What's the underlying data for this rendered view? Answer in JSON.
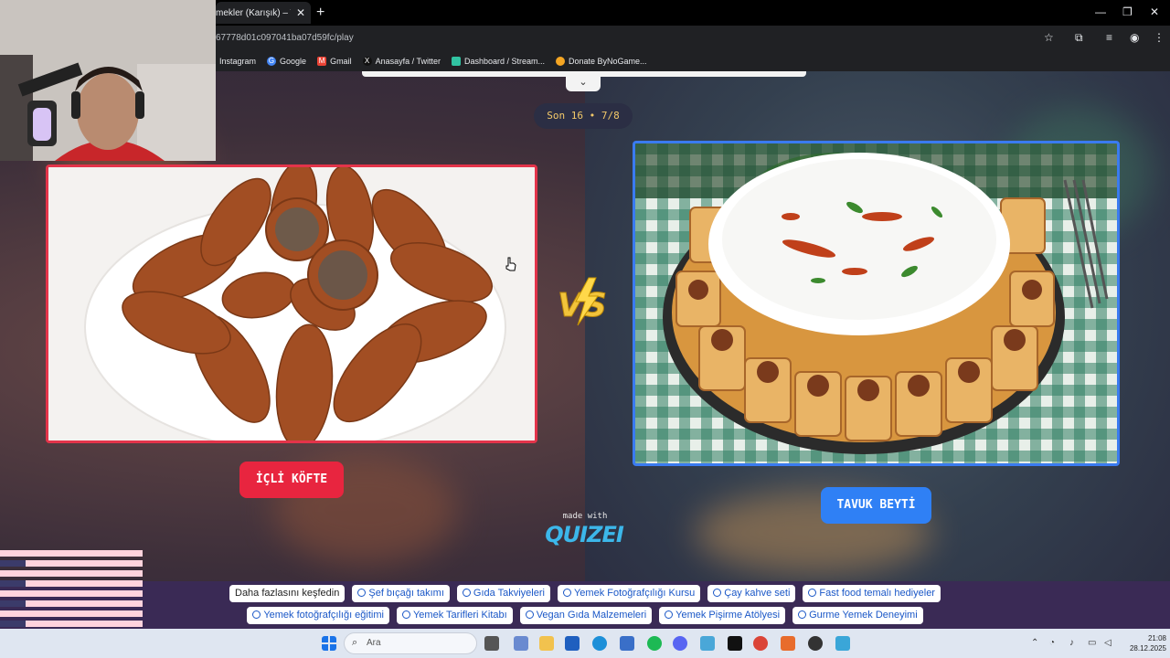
{
  "browser": {
    "tab_title": "mekler (Karışık) – Tier L",
    "tab_close": "✕",
    "new_tab": "+",
    "url": "67778d01c097041ba07d59fc/play",
    "window_controls": [
      "—",
      "❐",
      "✕"
    ],
    "bookmarks": [
      {
        "label": "Instagram",
        "icon": "instagram-icon",
        "color": "#555"
      },
      {
        "label": "Google",
        "icon": "google-icon",
        "color": "#4285f4"
      },
      {
        "label": "Gmail",
        "icon": "gmail-icon",
        "color": "#ea4335"
      },
      {
        "label": "Anasayfa / Twitter",
        "icon": "x-icon",
        "color": "#000000"
      },
      {
        "label": "Dashboard / Stream...",
        "icon": "streamlabs-icon",
        "color": "#31c3a2"
      },
      {
        "label": "Donate ByNoGame...",
        "icon": "bynogame-icon",
        "color": "#f5a623"
      }
    ]
  },
  "game": {
    "round_label": "Son 16 • 7/8",
    "dropdown_icon": "⌄",
    "left_choice": {
      "label": "İÇLİ KÖFTE",
      "border_color": "#e3344a",
      "button_color": "#e8253f"
    },
    "right_choice": {
      "label": "TAVUK BEYTİ",
      "border_color": "#3a7bf0",
      "button_color": "#2f80f5"
    },
    "vs_label": "VS",
    "made_with": "made with",
    "brand": "QUIZEI"
  },
  "ads": {
    "row1": [
      "Daha fazlasını keşfedin",
      "Şef bıçağı takımı",
      "Gıda Takviyeleri",
      "Yemek Fotoğrafçılığı Kursu",
      "Çay kahve seti",
      "Fast food temalı hediyeler"
    ],
    "row2": [
      "Yemek fotoğrafçılığı eğitimi",
      "Yemek Tarifleri Kitabı",
      "Vegan Gıda Malzemeleri",
      "Yemek Pişirme Atölyesi",
      "Gurme Yemek Deneyimi"
    ]
  },
  "taskbar": {
    "search_placeholder": "Ara",
    "time": "21:08",
    "date": "28.12.2025"
  }
}
